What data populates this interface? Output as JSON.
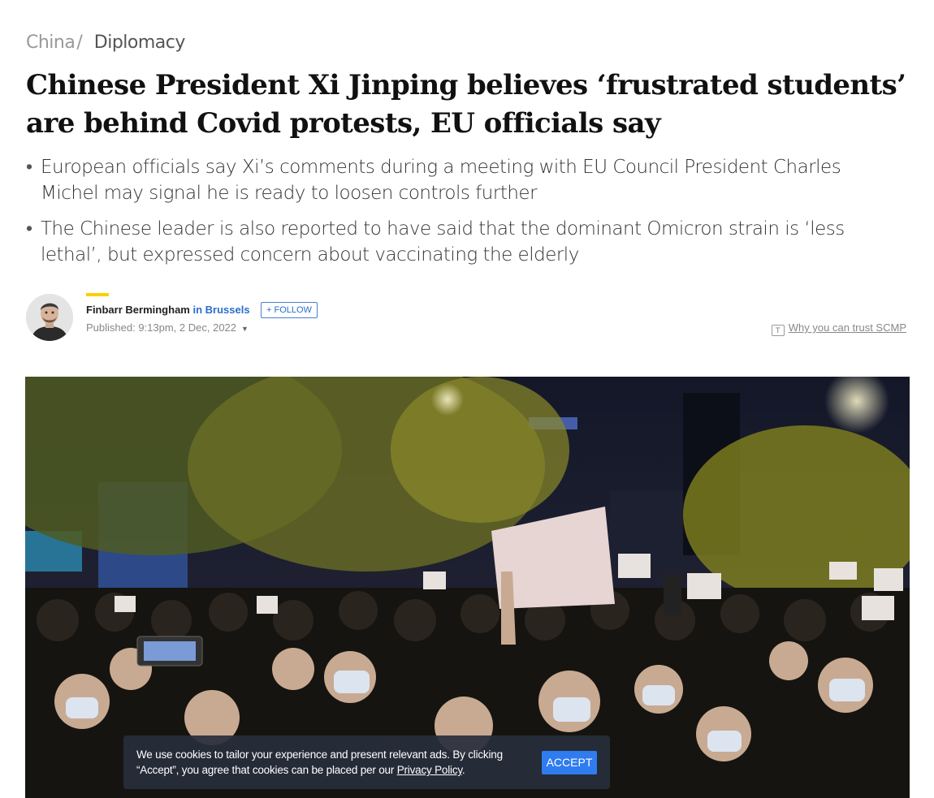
{
  "breadcrumb": {
    "section": "China",
    "separator": "/",
    "topic": "Diplomacy"
  },
  "headline": "Chinese President Xi Jinping believes ‘frustrated students’ are behind Covid protests, EU officials say",
  "summary": [
    "European officials say Xi’s comments during a meeting with EU Council President Charles Michel may signal he is ready to loosen controls further",
    "The Chinese leader is also reported to have said that the dominant Omicron strain is ‘less lethal’, but expressed concern about vaccinating the elderly"
  ],
  "byline": {
    "author": "Finbarr Bermingham",
    "location": "in Brussels",
    "follow_label": "+ FOLLOW",
    "published": "Published: 9:13pm, 2 Dec, 2022",
    "trust_link": "Why you can trust SCMP",
    "trust_icon_glyph": "T"
  },
  "cookie_banner": {
    "text_before": "We use cookies to tailor your experience and present relevant ads. By clicking “Accept”, you agree that cookies can be placed per our ",
    "link": "Privacy Policy",
    "text_after": ".",
    "accept_label": "ACCEPT"
  },
  "colors": {
    "accent_yellow": "#fcd000",
    "link_blue": "#2a6fc9",
    "button_blue": "#2f7cf0"
  }
}
